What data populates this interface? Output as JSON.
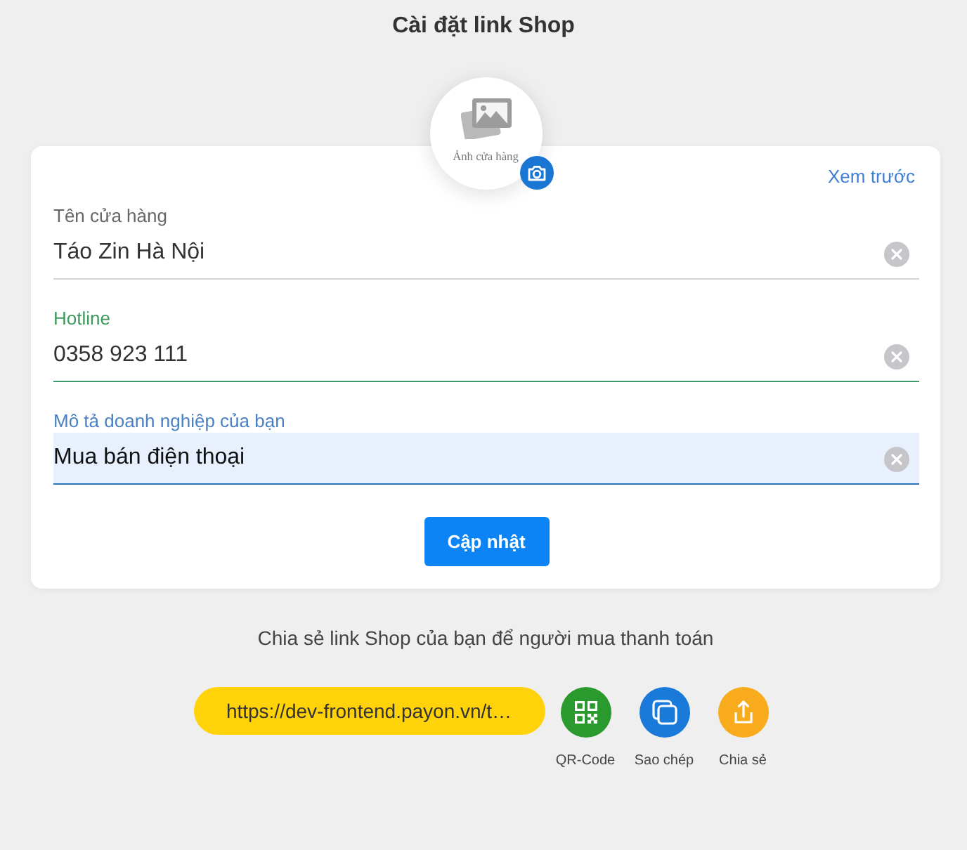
{
  "page": {
    "title": "Cài đặt link Shop"
  },
  "store_image": {
    "caption": "Ảnh cửa hàng"
  },
  "card": {
    "preview_link": "Xem trước",
    "fields": [
      {
        "label": "Tên cửa hàng",
        "value": "Táo Zin Hà Nội",
        "focused": false,
        "valid": false
      },
      {
        "label": "Hotline",
        "value": "0358 923 111",
        "focused": false,
        "valid": true
      },
      {
        "label": "Mô tả doanh nghiệp của bạn",
        "value": "Mua bán điện thoại",
        "focused": true,
        "valid": false
      }
    ],
    "submit_button": "Cập nhật"
  },
  "share": {
    "caption": "Chia sẻ link Shop của bạn để người mua thanh toán",
    "link": "https://dev-frontend.payon.vn/t…",
    "actions": [
      {
        "kind": "qr",
        "label": "QR-Code",
        "color": "#2b9a2e"
      },
      {
        "kind": "copy",
        "label": "Sao chép",
        "color": "#1a7ad9"
      },
      {
        "kind": "share",
        "label": "Chia sẻ",
        "color": "#f8ab1c"
      }
    ]
  }
}
